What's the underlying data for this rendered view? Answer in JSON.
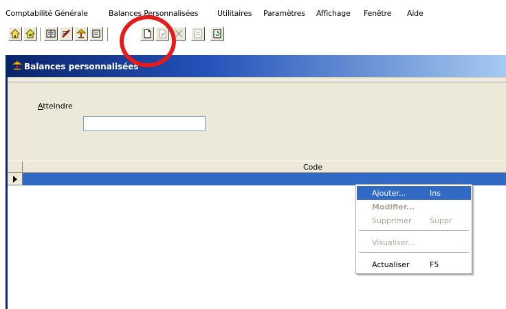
{
  "menubar": {
    "items": [
      "Comptabilité Générale",
      "Balances Personnalisées",
      "Utilitaires",
      "Paramètres",
      "Affichage",
      "Fenêtre",
      "Aide"
    ]
  },
  "toolbar": {
    "buttons": [
      {
        "name": "home-icon"
      },
      {
        "name": "home-alt-icon"
      },
      {
        "name": "book-icon"
      },
      {
        "name": "pen-icon"
      },
      {
        "name": "balance-icon"
      },
      {
        "name": "journal-icon"
      },
      {
        "name": "new-icon"
      },
      {
        "name": "edit-icon"
      },
      {
        "name": "delete-icon"
      },
      {
        "name": "view-icon"
      },
      {
        "name": "refresh-icon"
      }
    ],
    "highlight_color": "#e31b1b"
  },
  "window": {
    "title": "Balances personnalisées",
    "title_gradient_start": "#0a246a",
    "title_gradient_end": "#a6caf0",
    "atteindre": {
      "label_prefix": "A",
      "label_rest": "tteindre",
      "value": ""
    },
    "grid": {
      "columns": [
        "Code"
      ],
      "selected_row_color": "#316ac5"
    }
  },
  "context_menu": {
    "items": [
      {
        "label": "Ajouter...",
        "shortcut": "Ins",
        "state": "selected"
      },
      {
        "label": "Modifier...",
        "shortcut": "",
        "state": "disabled-bold"
      },
      {
        "label": "Supprimer",
        "shortcut": "Suppr",
        "state": "disabled"
      },
      {
        "label": "Visualiser...",
        "shortcut": "",
        "state": "disabled"
      },
      {
        "label": "Actualiser",
        "shortcut": "F5",
        "state": "enabled"
      }
    ]
  }
}
